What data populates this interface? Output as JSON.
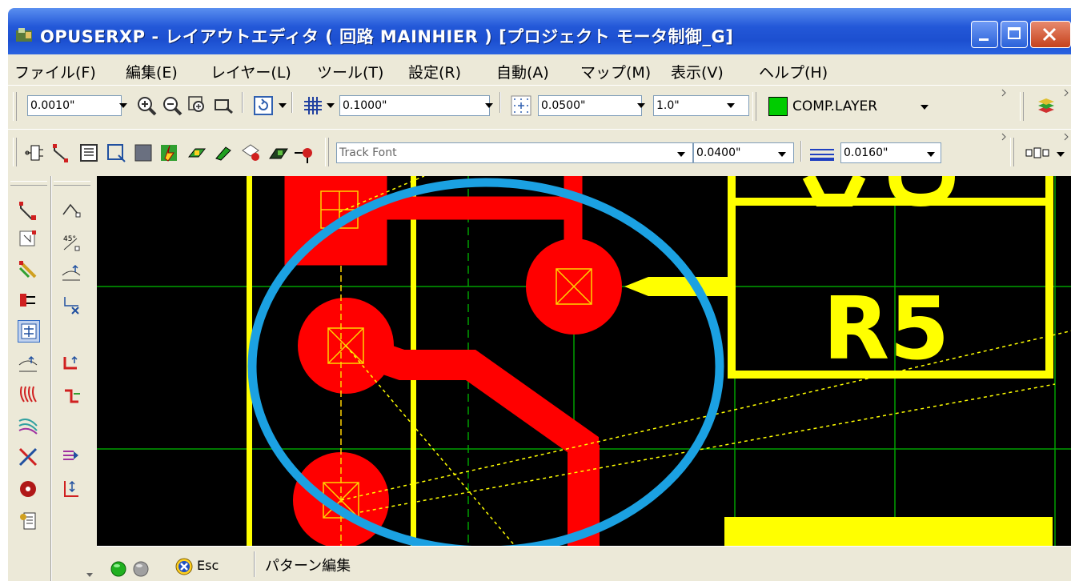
{
  "window": {
    "title": "OPUSERXP - レイアウトエディタ ( 回路 MAINHIER ) [プロジェクト モータ制御_G]",
    "controls": [
      "minimize",
      "maximize",
      "close"
    ]
  },
  "menu": [
    {
      "label": "ファイル(F)"
    },
    {
      "label": "編集(E)"
    },
    {
      "label": "レイヤー(L)"
    },
    {
      "label": "ツール(T)"
    },
    {
      "label": "設定(R)"
    },
    {
      "label": "自動(A)"
    },
    {
      "label": "マップ(M)"
    },
    {
      "label": "表示(V)"
    },
    {
      "label": "ヘルプ(H)"
    }
  ],
  "toolbar1": {
    "precision": "0.0010\"",
    "grid_size": "0.1000\"",
    "snap_size": "0.0500\"",
    "zoom": "1.0\"",
    "layer": "COMP.LAYER",
    "layer_color": "#00cc00"
  },
  "toolbar2": {
    "style": "Track Font",
    "trace_width": "0.0400\"",
    "line_width": "0.0160\""
  },
  "canvas": {
    "component_label": "R5",
    "colors": {
      "pad": "#ff0000",
      "silk": "#ffff00",
      "grid": "#00a000",
      "ratsnest": "#ffff00",
      "highlight": "#1ba1e2"
    }
  },
  "status": {
    "esc_label": "Esc",
    "message": "パターン編集"
  }
}
